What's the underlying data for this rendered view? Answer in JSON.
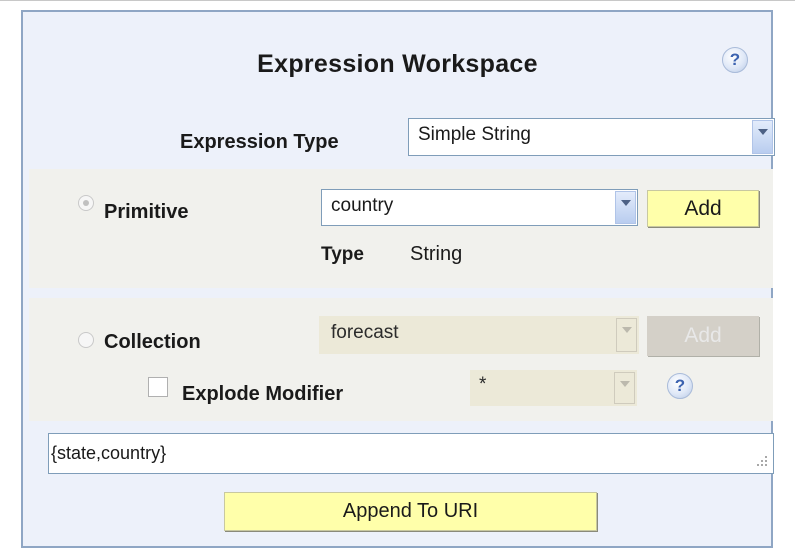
{
  "workspace": {
    "title": "Expression Workspace",
    "help_glyph": "?",
    "expression_type_label": "Expression Type",
    "expression_type_value": "Simple String"
  },
  "primitive": {
    "label": "Primitive",
    "selected": true,
    "value": "country",
    "add_label": "Add",
    "type_label": "Type",
    "type_value": "String"
  },
  "collection": {
    "label": "Collection",
    "selected": false,
    "value": "forecast",
    "add_label": "Add",
    "explode_label": "Explode Modifier",
    "explode_checked": false,
    "explode_value": "*"
  },
  "uri": {
    "value": "{state,country}",
    "append_label": "Append To URI"
  },
  "colors": {
    "panel_border": "#8fa6c4",
    "panel_bg": "#edf1fa",
    "button_bg": "#ffffaa",
    "section_bg": "#f1f1ed"
  },
  "icons": [
    "help-icon",
    "dropdown-arrow-icon",
    "resize-grip-icon"
  ]
}
